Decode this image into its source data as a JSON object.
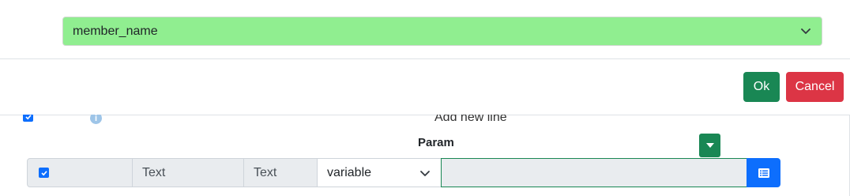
{
  "top_select": {
    "value": "member_name"
  },
  "buttons": {
    "ok": "Ok",
    "cancel": "Cancel"
  },
  "panel": {
    "add_new_line": "Add new line",
    "param_header": "Param",
    "row": {
      "checked": true,
      "text1": "Text",
      "text2": "Text",
      "select_value": "variable",
      "input_value": ""
    }
  },
  "colors": {
    "select_bg": "#90ee90",
    "ok": "#198754",
    "cancel": "#dc3545",
    "primary": "#0d6efd",
    "info": "#9ec5e8"
  },
  "icons": [
    "chevron-down-icon",
    "info-icon",
    "caret-down-icon",
    "list-icon",
    "checkbox-icon"
  ]
}
